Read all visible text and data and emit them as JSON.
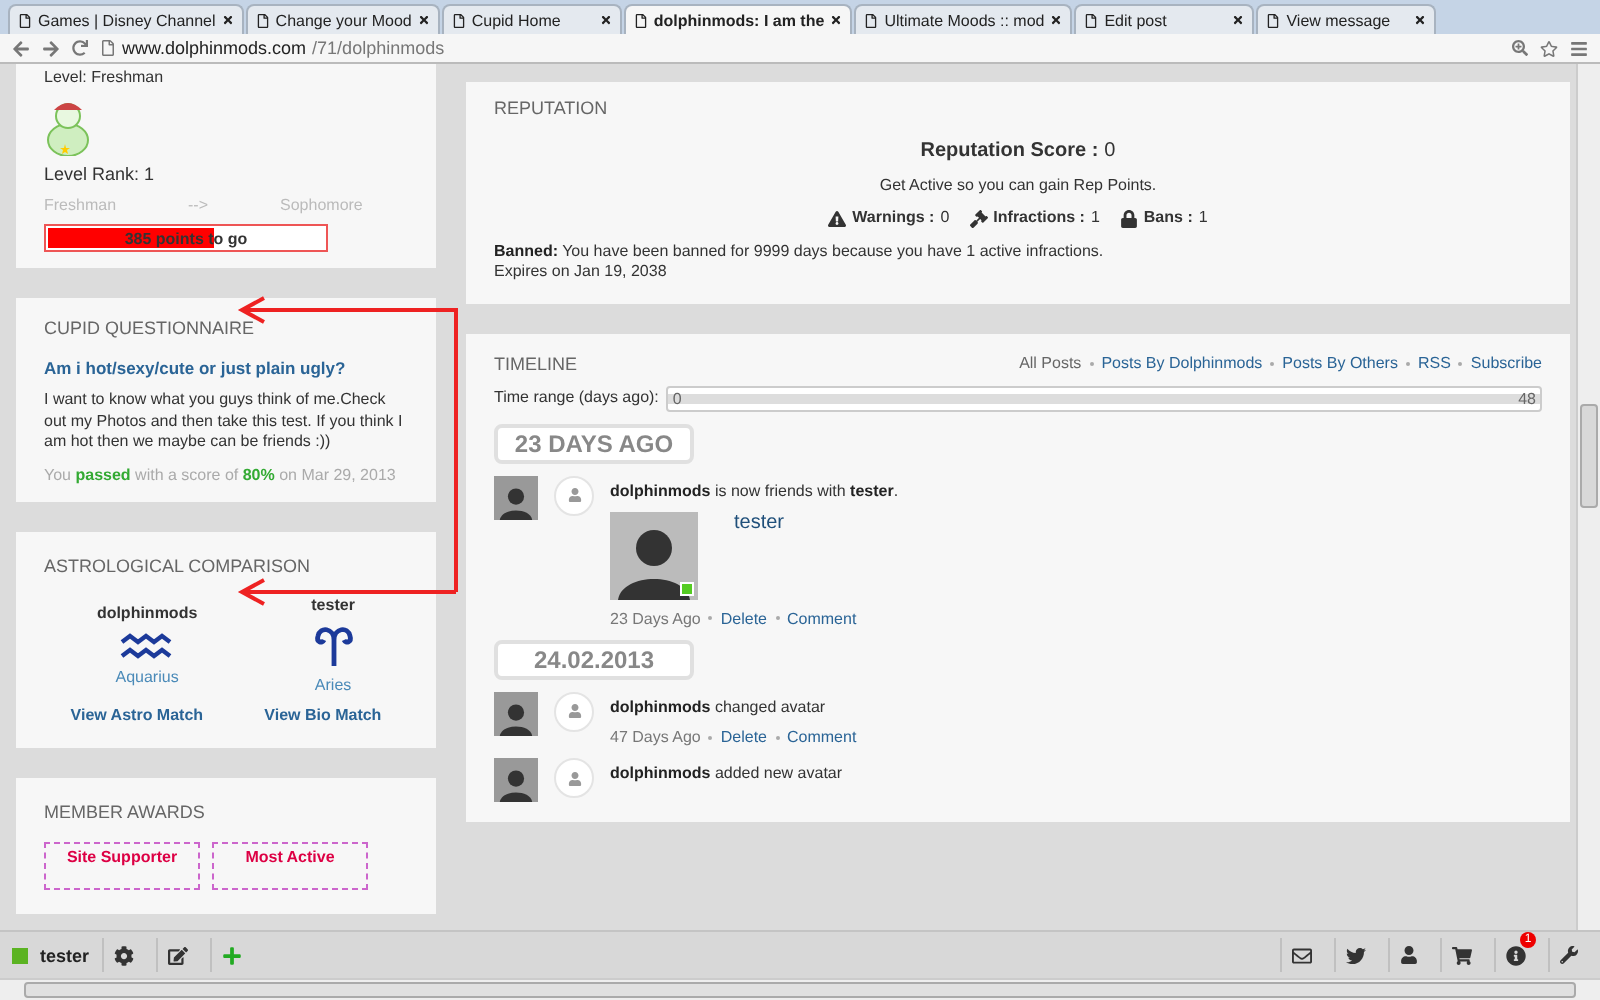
{
  "browser": {
    "tabs": [
      {
        "title": "Games | Disney Channel",
        "selected": false
      },
      {
        "title": "Change your Mood",
        "selected": false
      },
      {
        "title": "Cupid Home",
        "selected": false
      },
      {
        "title": "dolphinmods: I am the",
        "selected": true
      },
      {
        "title": "Ultimate Moods :: mod",
        "selected": false
      },
      {
        "title": "Edit post",
        "selected": false
      },
      {
        "title": "View message",
        "selected": false
      }
    ],
    "url": {
      "host": "www.dolphinmods.com",
      "path": "/71/dolphinmods"
    }
  },
  "level_card": {
    "level": "Level: Freshman",
    "rank": "Level Rank: 1",
    "from": "Freshman",
    "arrow": "-->",
    "to": "Sophomore",
    "progress": {
      "level": 0.61,
      "text": "385 points to go"
    }
  },
  "cupid": {
    "heading": "CUPID QUESTIONNAIRE",
    "question": "Am i hot/sexy/cute or just plain ugly?",
    "description": "I want to know what you guys think of me.Check out my Photos and then take this test. If you think I am hot then we maybe can be friends :))",
    "result": "You **passed** with a score of **80%** on Mar 29, 2013"
  },
  "astro": {
    "heading": "ASTROLOGICAL COMPARISON",
    "people": [
      {
        "name": "dolphinmods",
        "sign": "Aquarius",
        "kind": "aquarius"
      },
      {
        "name": "tester",
        "sign": "Aries",
        "kind": "aries"
      }
    ],
    "links": [
      "View Astro Match",
      "View Bio Match"
    ]
  },
  "awards": {
    "heading": "MEMBER AWARDS",
    "items": [
      "Site Supporter",
      "Most Active"
    ]
  },
  "reputation": {
    "heading": "REPUTATION",
    "score_label": "Reputation Score :",
    "score": "0",
    "hint": "Get Active so you can gain Rep Points.",
    "stats": [
      {
        "kind": "warning",
        "label": "Warnings :",
        "value": "0"
      },
      {
        "kind": "infraction",
        "label": "Infractions :",
        "value": "1"
      },
      {
        "kind": "ban",
        "label": "Bans :",
        "value": "1"
      }
    ],
    "ban_text": "**Banned:** You have been banned for 9999 days because you have 1 active infractions.",
    "expires": "Expires on Jan 19, 2038"
  },
  "timeline": {
    "heading": "TIMELINE",
    "filters": [
      {
        "label": "All Posts",
        "selected": true
      },
      {
        "label": "Posts By Dolphinmods",
        "selected": false
      },
      {
        "label": "Posts By Others",
        "selected": false
      },
      {
        "label": "RSS",
        "selected": false
      },
      {
        "label": "Subscribe",
        "selected": false
      }
    ],
    "range": {
      "label": "Time range (days ago):",
      "min": "0",
      "max": "48",
      "level": 1
    },
    "groups": [
      {
        "date": "23 DAYS AGO",
        "entries": [
          {
            "text": "**dolphinmods** is now friends with **tester**.",
            "card": {
              "name": "tester"
            },
            "time": "23 Days Ago",
            "actions": [
              "Delete",
              "Comment"
            ]
          }
        ]
      },
      {
        "date": "24.02.2013",
        "entries": [
          {
            "text": "**dolphinmods** changed avatar",
            "time": "47 Days Ago",
            "actions": [
              "Delete",
              "Comment"
            ]
          },
          {
            "text": "**dolphinmods** added new avatar"
          }
        ]
      }
    ]
  },
  "bottom_bar": {
    "user": "tester",
    "notifications": "1"
  }
}
